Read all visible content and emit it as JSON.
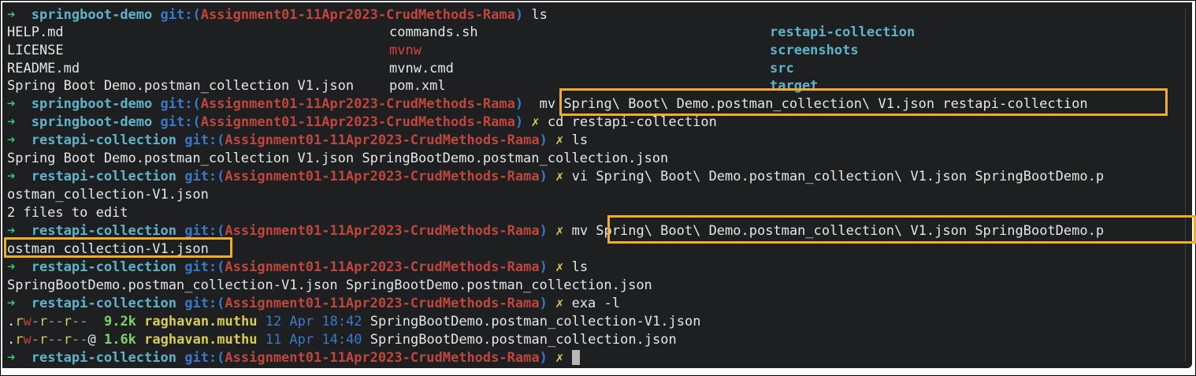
{
  "prompt": {
    "arrow": "➜",
    "dir_demo": "springboot-demo",
    "dir_restapi": "restapi-collection",
    "git": "git:(",
    "branch": "Assignment01-11Apr2023-CrudMethods-Rama",
    "close": ")",
    "x": "✗"
  },
  "lines": {
    "l0_cmd": "ls",
    "ls1": {
      "r1": [
        "HELP.md",
        "commands.sh",
        "restapi-collection"
      ],
      "r2": [
        "LICENSE",
        "mvnw",
        "screenshots"
      ],
      "r3": [
        "README.md",
        "mvnw.cmd",
        "src"
      ],
      "r4": [
        "Spring Boot Demo.postman_collection V1.json",
        "pom.xml",
        "target"
      ]
    },
    "l5_cmd": "mv Spring\\ Boot\\ Demo.postman_collection\\ V1.json restapi-collection",
    "l6_cmd": "cd restapi-collection",
    "l7_cmd": "ls",
    "l8_out": "Spring Boot Demo.postman_collection V1.json SpringBootDemo.postman_collection.json",
    "l9_cmd": "vi Spring\\ Boot\\ Demo.postman_collection\\ V1.json SpringBootDemo.p",
    "l10_out": "ostman_collection-V1.json",
    "l11_out": "2 files to edit",
    "l12_cmd": "mv Spring\\ Boot\\ Demo.postman_collection\\ V1.json SpringBootDemo.p",
    "l13_out": "ostman_collection-V1.json",
    "l14_cmd": "ls",
    "l15_out": "SpringBootDemo.postman_collection-V1.json SpringBootDemo.postman_collection.json",
    "l16_cmd": "exa -l",
    "exa": [
      {
        "dot": ".",
        "r1": "r",
        "w": "w",
        "d1": "-",
        "r2": "r",
        "d2": "--",
        "r3": "r",
        "d3": "--",
        "at": " ",
        "size": "9.2k",
        "user": "raghavan.muthu",
        "date": "12 Apr 18:42",
        "name": "SpringBootDemo.postman_collection-V1.json"
      },
      {
        "dot": ".",
        "r1": "r",
        "w": "w",
        "d1": "-",
        "r2": "r",
        "d2": "--",
        "r3": "r",
        "d3": "--",
        "at": "@",
        "size": "1.6k",
        "user": "raghavan.muthu",
        "date": "11 Apr 14:40",
        "name": "SpringBootDemo.postman_collection.json"
      }
    ]
  },
  "colors": {
    "terminal_bg": "#1d1f21",
    "highlight": "#f0ad2c",
    "prompt_arrow": "#3cc46a",
    "prompt_dir": "#5fb3c9",
    "git_label": "#3a78c8",
    "branch": "#c0463d",
    "dirty_mark": "#d8cc55"
  },
  "icons": {
    "cursor": "block-cursor"
  }
}
